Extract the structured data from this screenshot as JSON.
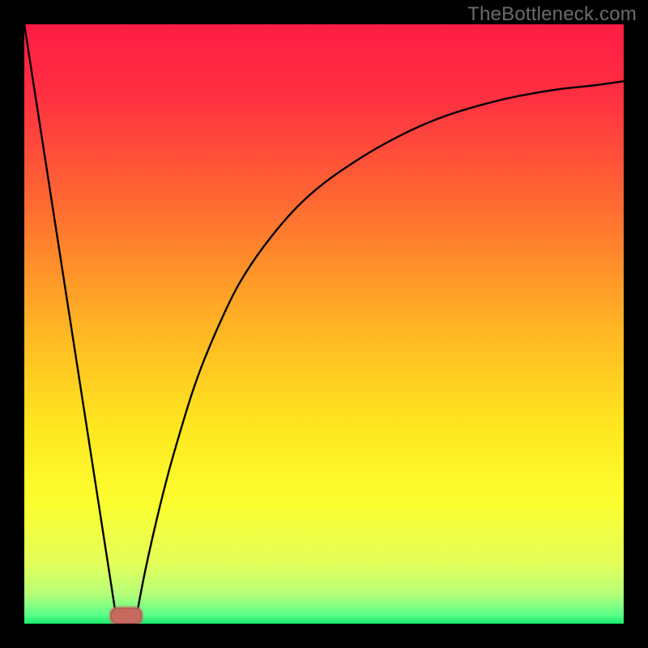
{
  "watermark": "TheBottleneck.com",
  "colors": {
    "background": "#000000",
    "gradient_stops": [
      {
        "offset": 0.0,
        "color": "#ff1c44"
      },
      {
        "offset": 0.12,
        "color": "#ff3042"
      },
      {
        "offset": 0.3,
        "color": "#ff6a32"
      },
      {
        "offset": 0.5,
        "color": "#ffb324"
      },
      {
        "offset": 0.67,
        "color": "#ffe61f"
      },
      {
        "offset": 0.8,
        "color": "#fbff30"
      },
      {
        "offset": 0.9,
        "color": "#e3ff5a"
      },
      {
        "offset": 0.95,
        "color": "#b6ff78"
      },
      {
        "offset": 0.985,
        "color": "#5cff8a"
      },
      {
        "offset": 1.0,
        "color": "#17e86b"
      }
    ],
    "curve": "#000000",
    "marker_fill": "#c66a5f",
    "marker_stroke": "#a8504a"
  },
  "chart_data": {
    "type": "line",
    "title": "",
    "xlabel": "",
    "ylabel": "",
    "xlim": [
      0,
      100
    ],
    "ylim": [
      0,
      100
    ],
    "grid": false,
    "legend": false,
    "annotations": [],
    "series": [
      {
        "name": "left-branch",
        "x": [
          0.0,
          2.0,
          4.0,
          6.0,
          8.0,
          10.0,
          12.0,
          14.0,
          15.5
        ],
        "y": [
          100.0,
          87.1,
          74.2,
          61.3,
          48.4,
          35.5,
          22.6,
          9.7,
          0.0
        ]
      },
      {
        "name": "right-branch",
        "x": [
          18.5,
          20.0,
          22.0,
          24.0,
          26.0,
          28.0,
          30.0,
          33.0,
          36.0,
          40.0,
          45.0,
          50.0,
          55.0,
          60.0,
          66.0,
          72.0,
          80.0,
          88.0,
          95.0,
          100.0
        ],
        "y": [
          0.0,
          8.0,
          17.0,
          25.0,
          32.0,
          38.5,
          44.0,
          51.0,
          57.0,
          63.0,
          69.0,
          73.5,
          77.0,
          80.0,
          83.0,
          85.3,
          87.5,
          89.0,
          89.8,
          90.5
        ]
      }
    ],
    "marker": {
      "name": "bottom-marker",
      "shape": "capsule-horizontal",
      "x_center": 17.0,
      "y_center": 1.3,
      "width": 5.0,
      "height": 2.5
    }
  }
}
